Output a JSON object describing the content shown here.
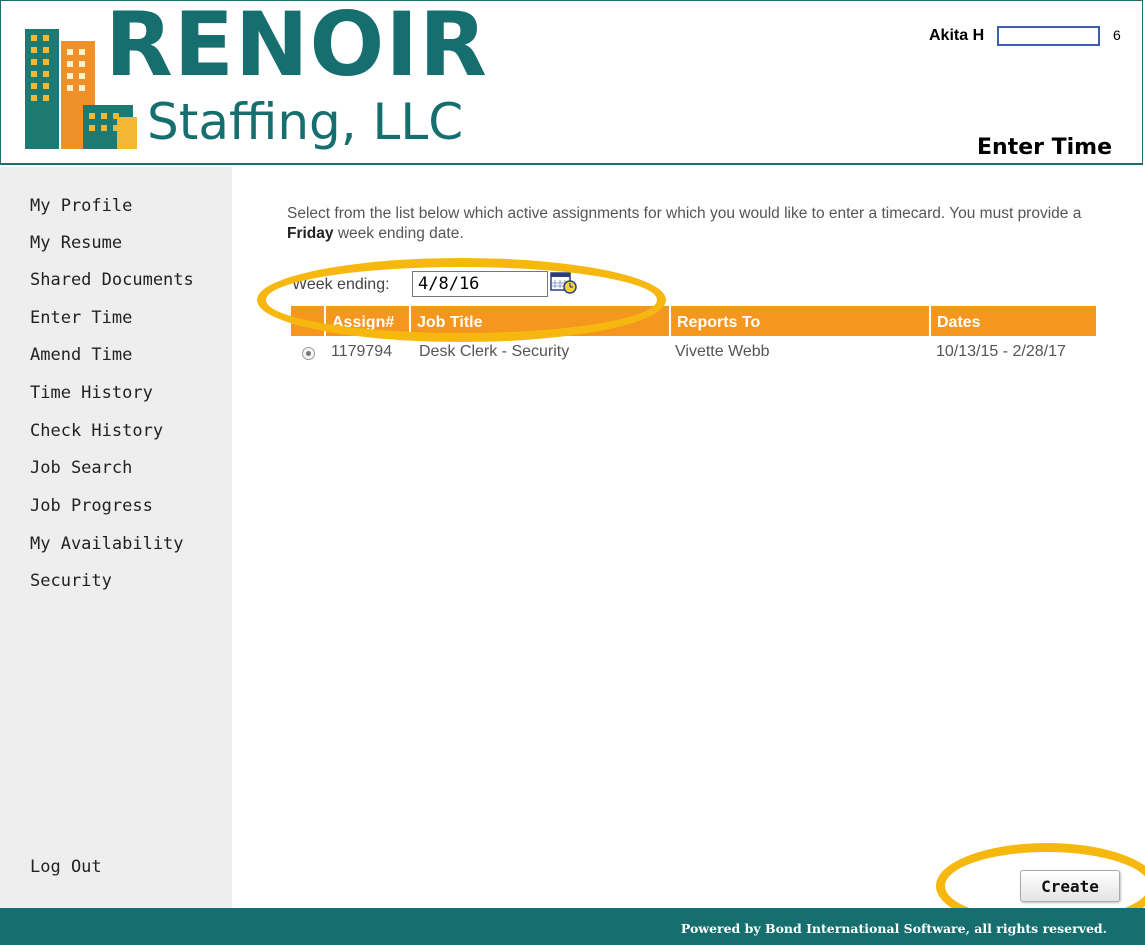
{
  "header": {
    "logo_word": "RENOIR",
    "logo_sub": "Staffing, LLC",
    "user_name": "Akita H",
    "user_suffix": "6",
    "page_title": "Enter Time"
  },
  "sidebar": {
    "items": [
      {
        "label": "My Profile"
      },
      {
        "label": "My Resume"
      },
      {
        "label": "Shared Documents"
      },
      {
        "label": "Enter Time"
      },
      {
        "label": "Amend Time"
      },
      {
        "label": "Time History"
      },
      {
        "label": "Check History"
      },
      {
        "label": "Job Search"
      },
      {
        "label": "Job Progress"
      },
      {
        "label": "My Availability"
      },
      {
        "label": "Security"
      }
    ],
    "logout_label": "Log Out"
  },
  "main": {
    "instructions_part1": "Select from the list below which active assignments for which you would like to enter a timecard. You must provide a ",
    "instructions_bold": "Friday",
    "instructions_part2": " week ending date.",
    "week_ending_label": "Week ending:",
    "week_ending_value": "4/8/16",
    "table": {
      "headers": {
        "assign": "Assign#",
        "title": "Job Title",
        "reports": "Reports To",
        "dates": "Dates"
      },
      "rows": [
        {
          "assign": "1179794",
          "title": "Desk Clerk - Security",
          "reports": "Vivette Webb",
          "dates": "10/13/15 - 2/28/17"
        }
      ]
    },
    "create_label": "Create"
  },
  "footer": {
    "text": "Powered by Bond International Software, all rights reserved."
  },
  "colors": {
    "brand_teal": "#176e6f",
    "header_orange": "#f5961f",
    "annotation_yellow": "#f6b80f"
  },
  "icons": {
    "logo": "building-logo-icon",
    "calendar": "calendar-clock-icon",
    "radio": "radio-selected-icon"
  }
}
